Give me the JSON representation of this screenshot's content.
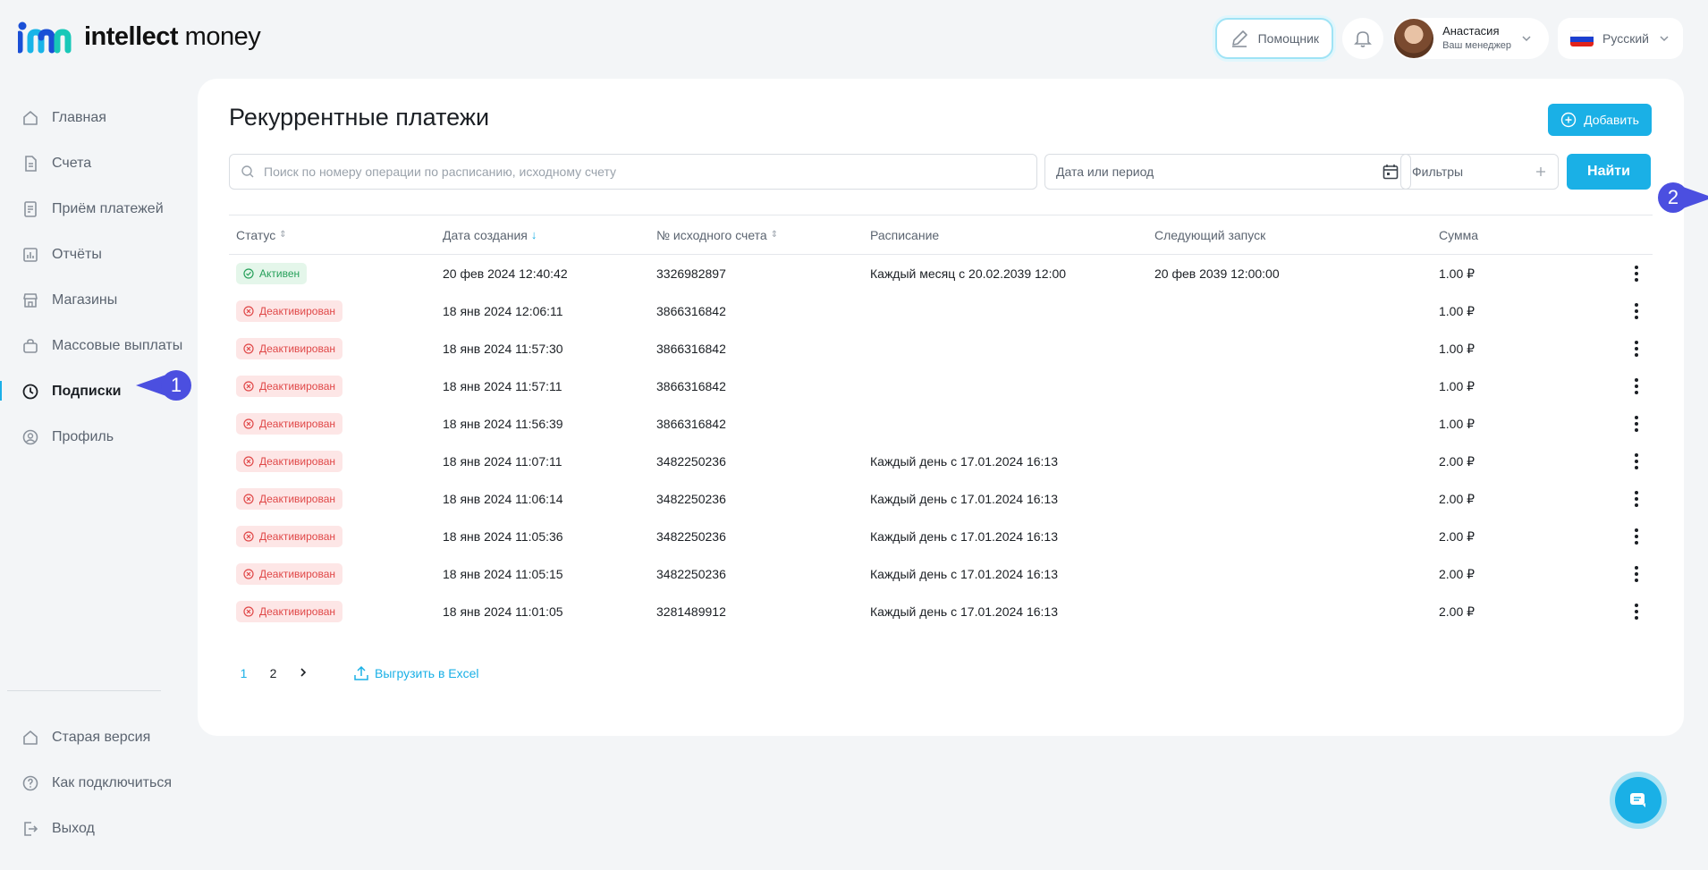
{
  "brand": {
    "name_bold": "intellect",
    "name_regular": "money",
    "accent": "#1ab0e6"
  },
  "header": {
    "helper_label": "Помощник",
    "manager_name": "Анастасия",
    "manager_role": "Ваш менеджер",
    "language": "Русский"
  },
  "sidebar": {
    "items": [
      {
        "label": "Главная",
        "icon": "home-icon"
      },
      {
        "label": "Счета",
        "icon": "document-icon"
      },
      {
        "label": "Приём платежей",
        "icon": "receipt-icon"
      },
      {
        "label": "Отчёты",
        "icon": "chart-icon"
      },
      {
        "label": "Магазины",
        "icon": "store-icon"
      },
      {
        "label": "Массовые выплаты",
        "icon": "bag-icon"
      },
      {
        "label": "Подписки",
        "icon": "clock-icon",
        "active": true
      },
      {
        "label": "Профиль",
        "icon": "user-icon"
      }
    ],
    "bottom": [
      {
        "label": "Старая версия",
        "icon": "home-icon"
      },
      {
        "label": "Как подключиться",
        "icon": "question-icon"
      },
      {
        "label": "Выход",
        "icon": "logout-icon"
      }
    ]
  },
  "callouts": {
    "one": "1",
    "two": "2"
  },
  "page": {
    "title": "Рекуррентные платежи",
    "add_label": "Добавить",
    "search_placeholder": "Поиск по номеру операции по расписанию, исходному счету",
    "date_placeholder": "Дата или период",
    "filters_label": "Фильтры",
    "find_label": "Найти"
  },
  "table": {
    "columns": {
      "status": "Статус",
      "created": "Дата создания",
      "account": "№ исходного счета",
      "schedule": "Расписание",
      "next_run": "Следующий запуск",
      "amount": "Сумма"
    },
    "rows": [
      {
        "status": "Активен",
        "state": "active",
        "created": "20 фев 2024 12:40:42",
        "account": "3326982897",
        "schedule": "Каждый месяц с 20.02.2039 12:00",
        "next_run": "20 фев 2039 12:00:00",
        "amount": "1.00 ₽"
      },
      {
        "status": "Деактивирован",
        "state": "inactive",
        "created": "18 янв 2024 12:06:11",
        "account": "3866316842",
        "schedule": "",
        "next_run": "",
        "amount": "1.00 ₽"
      },
      {
        "status": "Деактивирован",
        "state": "inactive",
        "created": "18 янв 2024 11:57:30",
        "account": "3866316842",
        "schedule": "",
        "next_run": "",
        "amount": "1.00 ₽"
      },
      {
        "status": "Деактивирован",
        "state": "inactive",
        "created": "18 янв 2024 11:57:11",
        "account": "3866316842",
        "schedule": "",
        "next_run": "",
        "amount": "1.00 ₽"
      },
      {
        "status": "Деактивирован",
        "state": "inactive",
        "created": "18 янв 2024 11:56:39",
        "account": "3866316842",
        "schedule": "",
        "next_run": "",
        "amount": "1.00 ₽"
      },
      {
        "status": "Деактивирован",
        "state": "inactive",
        "created": "18 янв 2024 11:07:11",
        "account": "3482250236",
        "schedule": "Каждый день с 17.01.2024 16:13",
        "next_run": "",
        "amount": "2.00 ₽"
      },
      {
        "status": "Деактивирован",
        "state": "inactive",
        "created": "18 янв 2024 11:06:14",
        "account": "3482250236",
        "schedule": "Каждый день с 17.01.2024 16:13",
        "next_run": "",
        "amount": "2.00 ₽"
      },
      {
        "status": "Деактивирован",
        "state": "inactive",
        "created": "18 янв 2024 11:05:36",
        "account": "3482250236",
        "schedule": "Каждый день с 17.01.2024 16:13",
        "next_run": "",
        "amount": "2.00 ₽"
      },
      {
        "status": "Деактивирован",
        "state": "inactive",
        "created": "18 янв 2024 11:05:15",
        "account": "3482250236",
        "schedule": "Каждый день с 17.01.2024 16:13",
        "next_run": "",
        "amount": "2.00 ₽"
      },
      {
        "status": "Деактивирован",
        "state": "inactive",
        "created": "18 янв 2024 11:01:05",
        "account": "3281489912",
        "schedule": "Каждый день с 17.01.2024 16:13",
        "next_run": "",
        "amount": "2.00 ₽"
      }
    ]
  },
  "pagination": {
    "pages": [
      "1",
      "2"
    ],
    "current": "1",
    "export_label": "Выгрузить в Excel"
  }
}
